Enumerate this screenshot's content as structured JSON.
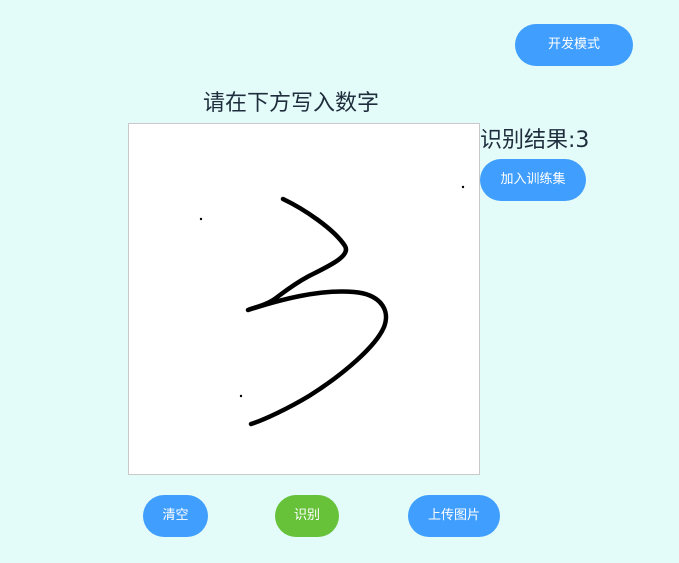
{
  "header": {
    "dev_mode_label": "开发模式"
  },
  "prompt": {
    "text": "请在下方写入数字"
  },
  "result": {
    "label": "识别结果:",
    "value": "3"
  },
  "actions": {
    "add_to_training_label": "加入训练集",
    "clear_label": "清空",
    "recognize_label": "识别",
    "upload_label": "上传图片"
  },
  "colors": {
    "background": "#e3fcf9",
    "primary": "#409eff",
    "success": "#67c23a",
    "ink": "#000000"
  }
}
